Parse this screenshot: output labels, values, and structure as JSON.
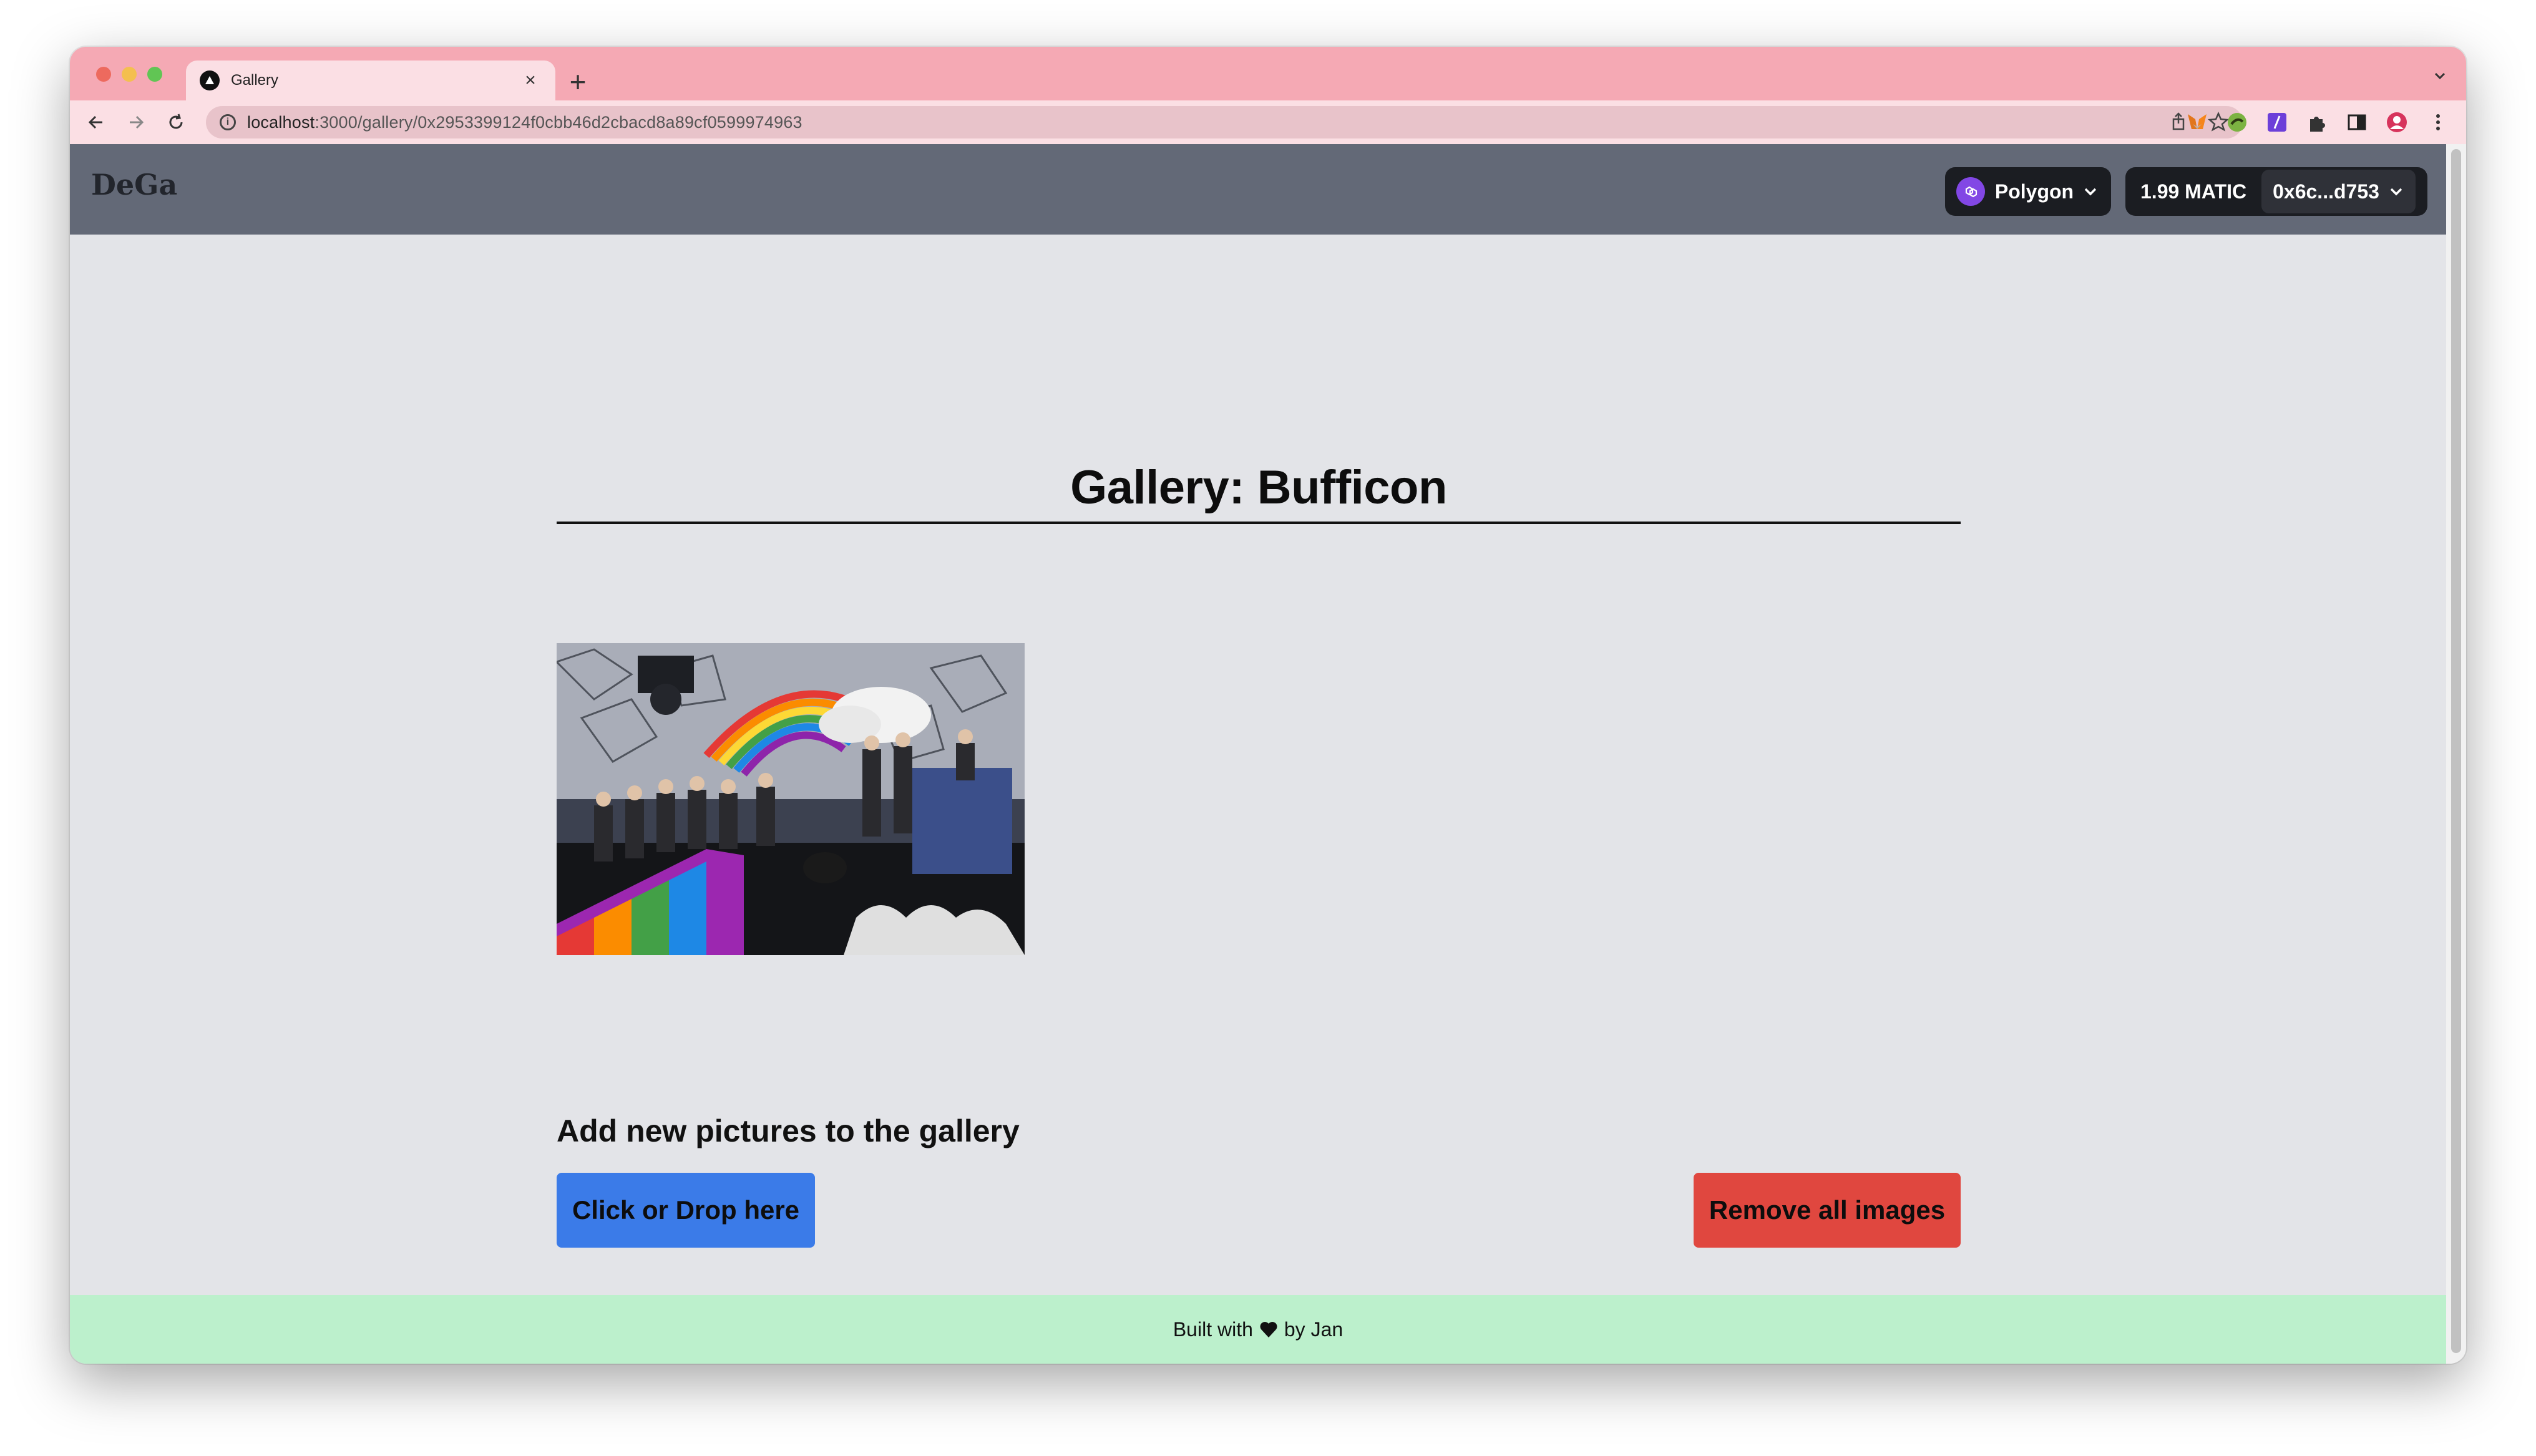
{
  "browser": {
    "tab_title": "Gallery",
    "url_host": "localhost",
    "url_path": ":3000/gallery/0x2953399124f0cbb46d2cbacd8a89cf0599974963"
  },
  "header": {
    "logo": "DeGa",
    "network_label": "Polygon",
    "balance": "1.99 MATIC",
    "address": "0x6c...d753"
  },
  "main": {
    "title": "Gallery: Bufficon",
    "add_heading": "Add new pictures to the gallery",
    "upload_button": "Click or Drop here",
    "remove_button": "Remove all images"
  },
  "footer": {
    "prefix": "Built with",
    "suffix": "by Jan"
  },
  "colors": {
    "tabstrip": "#f5a9b4",
    "app_header": "#636977",
    "upload_button": "#3b7be8",
    "remove_button": "#e0473f",
    "footer": "#bcf0cc",
    "polygon": "#8247e5"
  }
}
